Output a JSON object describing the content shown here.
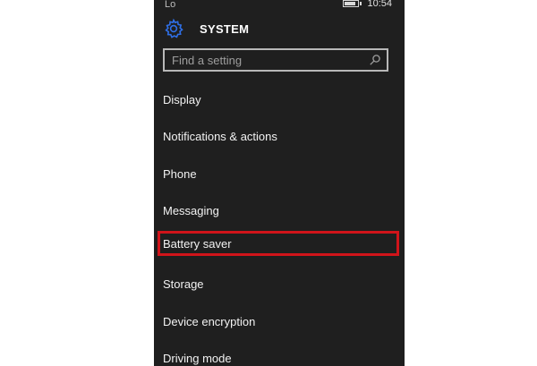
{
  "status_bar": {
    "left_glyph": "Lo",
    "time": "10:54"
  },
  "header": {
    "title": "SYSTEM",
    "icon": "gear-icon"
  },
  "search": {
    "placeholder": "Find a setting",
    "icon": "search-icon"
  },
  "menu": {
    "items": [
      {
        "label": "Display"
      },
      {
        "label": "Notifications & actions"
      },
      {
        "label": "Phone"
      },
      {
        "label": "Messaging"
      },
      {
        "label": "Battery saver",
        "highlighted": true
      },
      {
        "label": "Storage"
      },
      {
        "label": "Device encryption"
      },
      {
        "label": "Driving mode"
      }
    ]
  },
  "colors": {
    "background": "#1f1f1f",
    "accent": "#2f6fe6",
    "highlight": "#d0141a",
    "text": "#f2f2f2"
  }
}
